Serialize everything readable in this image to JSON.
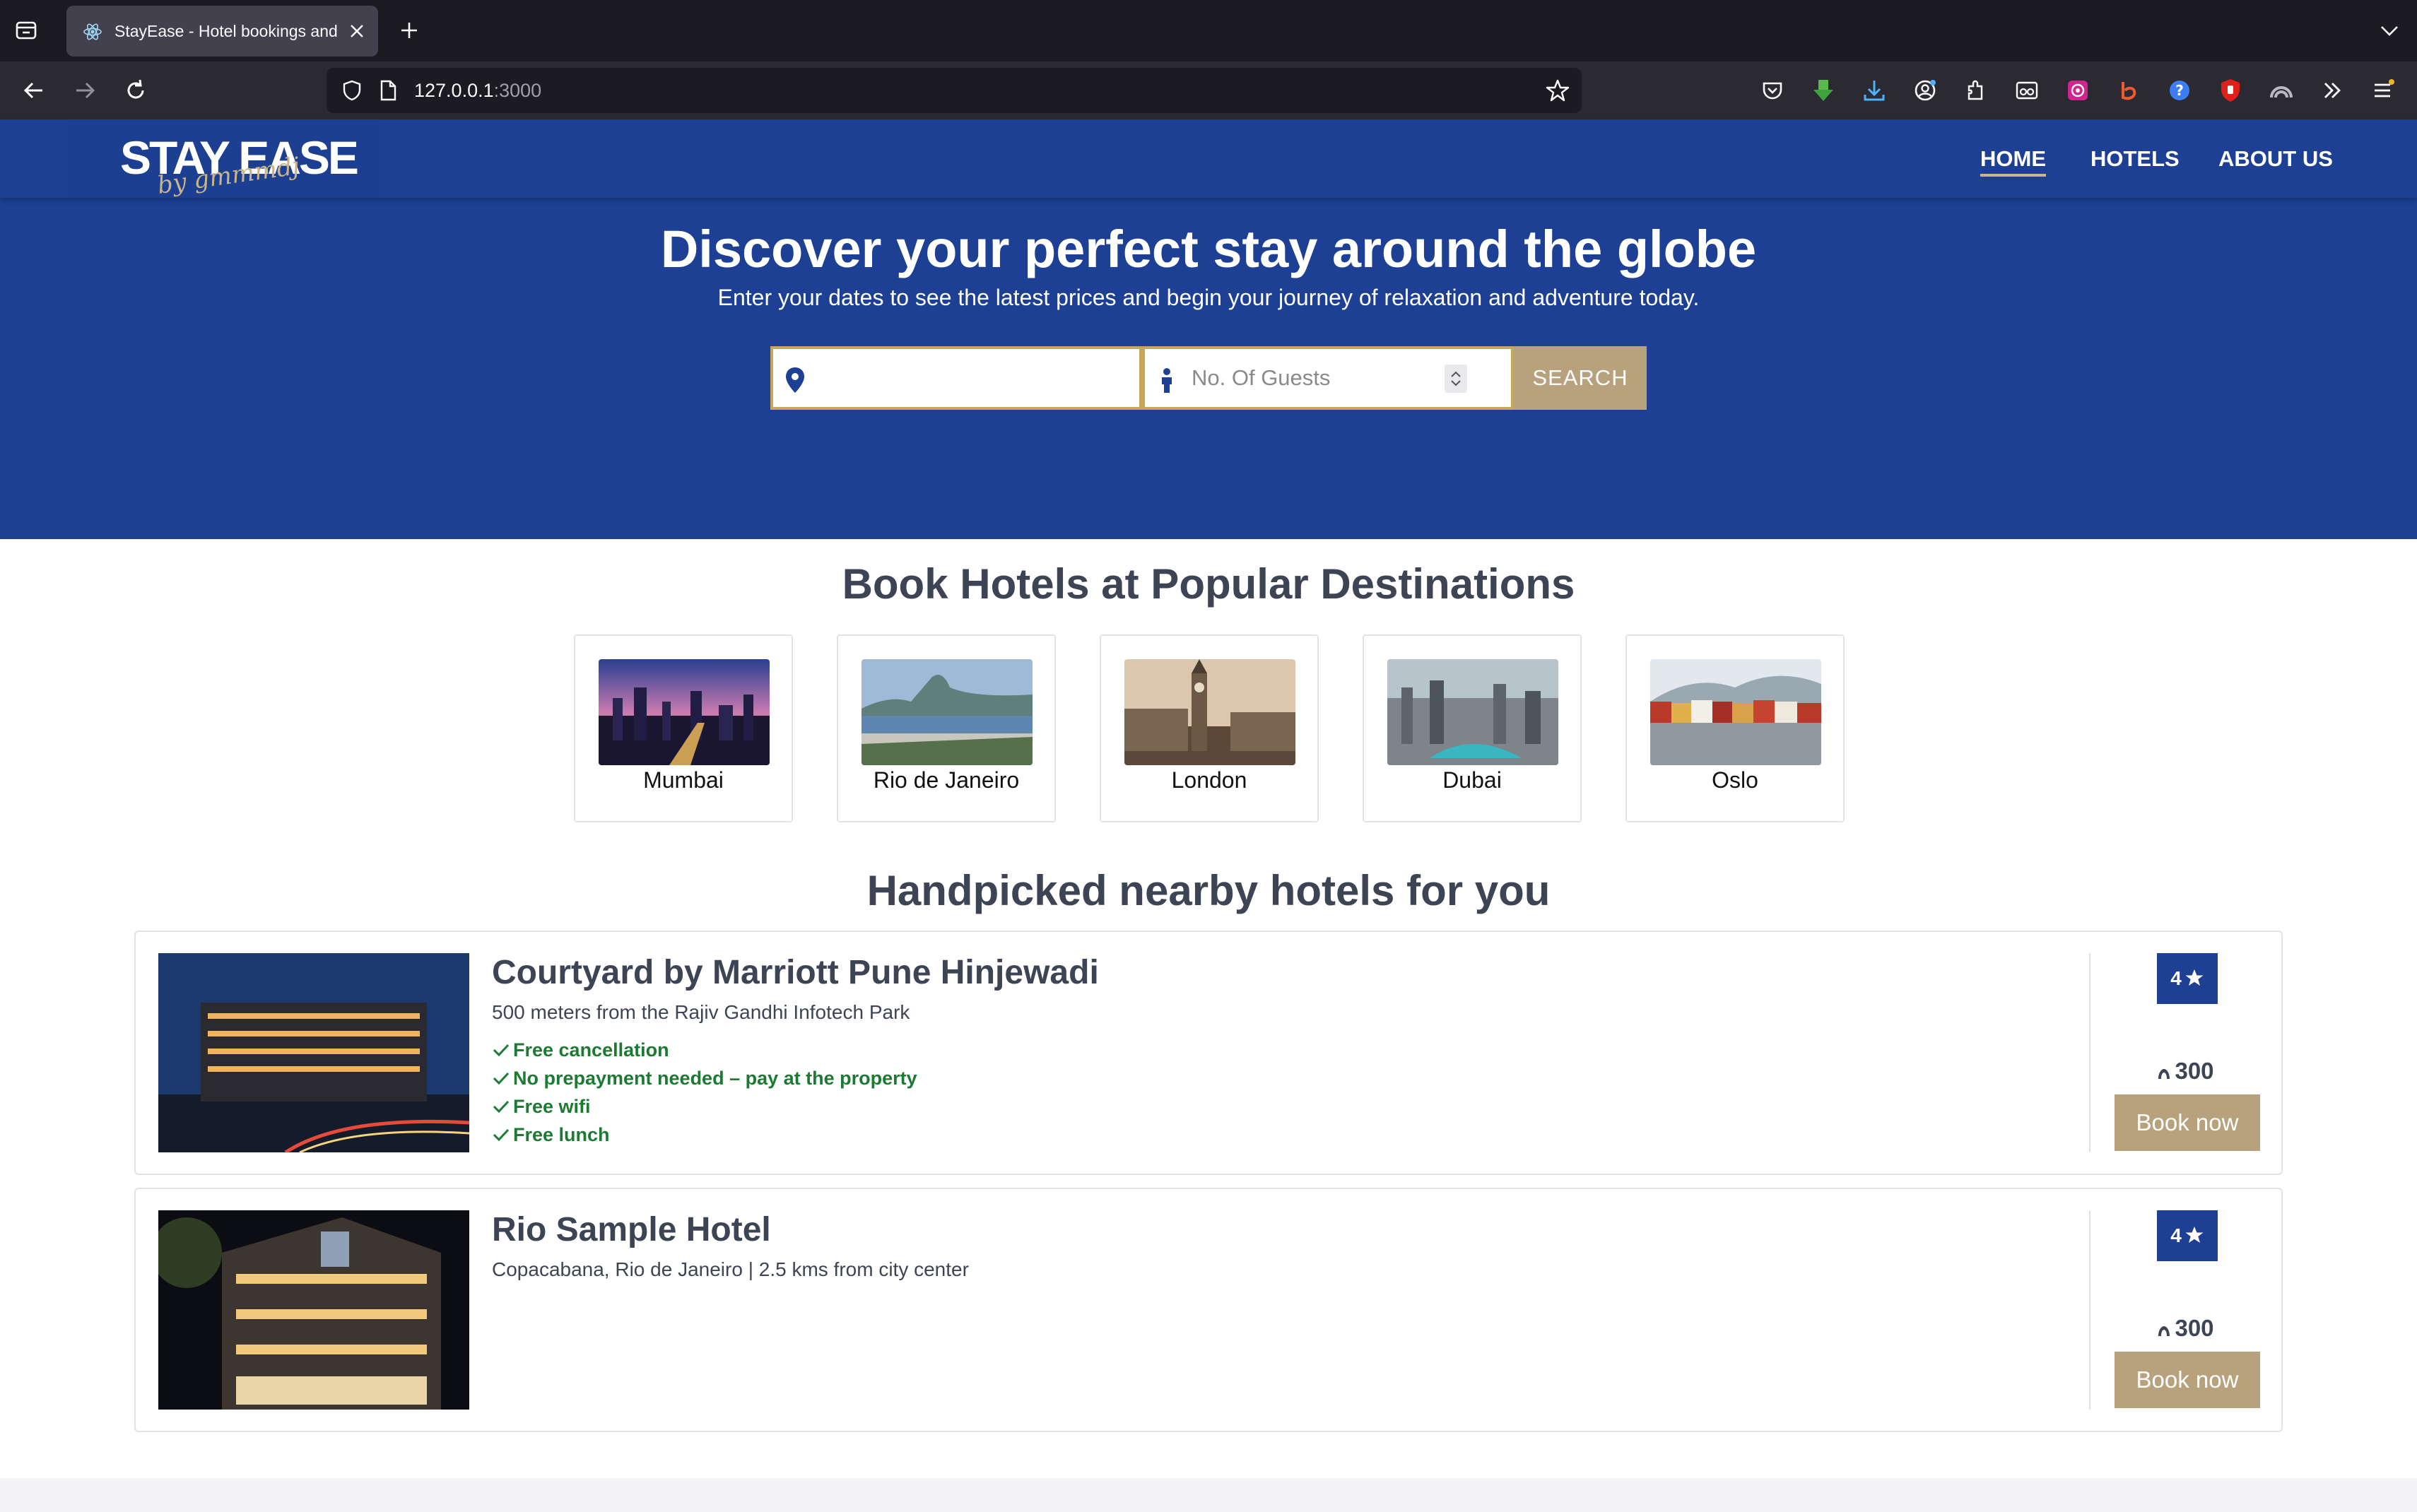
{
  "browser": {
    "tab_title": "StayEase - Hotel bookings and reservations",
    "url_host": "127.0.0.1",
    "url_port": ":3000"
  },
  "site": {
    "logo_text": "STAY EASE",
    "logo_script": "by gmmmdj",
    "nav": {
      "home": "HOME",
      "hotels": "HOTELS",
      "about": "ABOUT US"
    }
  },
  "hero": {
    "title": "Discover your perfect stay around the globe",
    "subtitle": "Enter your dates to see the latest prices and begin your journey of relaxation and adventure today.",
    "destination_value": "",
    "guests_placeholder": "No. Of Guests",
    "search_label": "SEARCH"
  },
  "destinations": {
    "title": "Book Hotels at Popular Destinations",
    "items": [
      {
        "name": "Mumbai"
      },
      {
        "name": "Rio de Janeiro"
      },
      {
        "name": "London"
      },
      {
        "name": "Dubai"
      },
      {
        "name": "Oslo"
      }
    ]
  },
  "hotels": {
    "title": "Handpicked nearby hotels for you",
    "items": [
      {
        "name": "Courtyard by Marriott Pune Hinjewadi",
        "location": "500 meters from the Rajiv Gandhi Infotech Park",
        "amenities": [
          "Free cancellation",
          "No prepayment needed – pay at the property",
          "Free wifi",
          "Free lunch"
        ],
        "rating": "4",
        "price": "300",
        "book_label": "Book now"
      },
      {
        "name": "Rio Sample Hotel",
        "location": "Copacabana, Rio de Janeiro | 2.5 kms from city center",
        "amenities": [],
        "rating": "4",
        "price": "300",
        "book_label": "Book now"
      }
    ]
  },
  "colors": {
    "brand_blue": "#1d4094",
    "accent_gold": "#b8a27e",
    "amenity_green": "#1d7a33"
  }
}
